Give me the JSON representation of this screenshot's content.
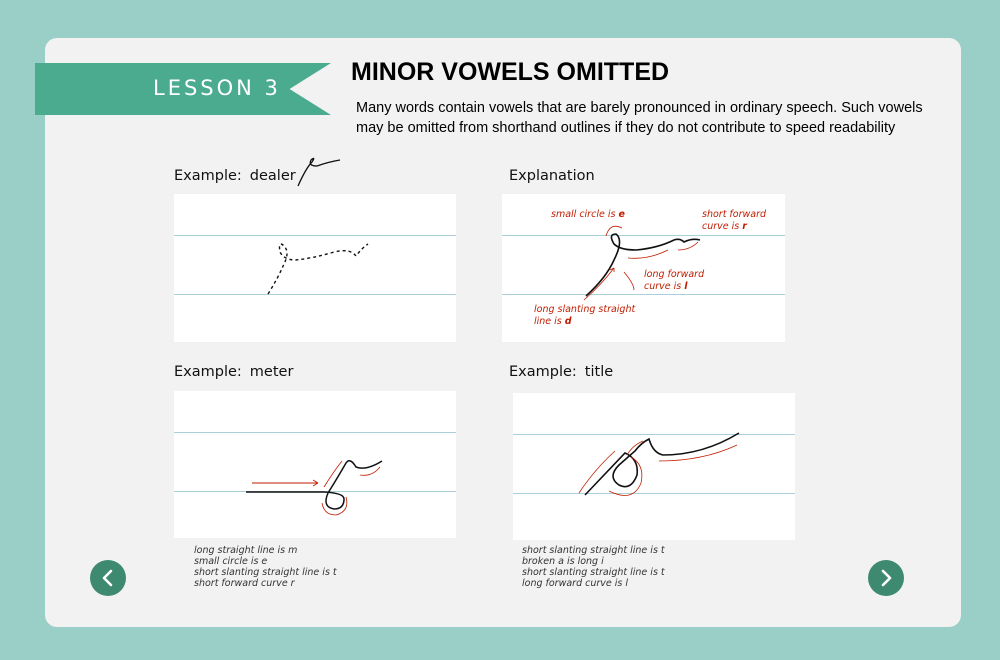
{
  "lesson": {
    "label": "LESSON 3"
  },
  "title": "MINOR VOWELS OMITTED",
  "intro": "Many words contain vowels that are barely pronounced in ordinary speech. Such vowels may be omitted from shorthand outlines if they do not contribute to speed readability",
  "examples": [
    {
      "prefix": "Example:",
      "word": "dealer"
    },
    {
      "prefix": "Example:",
      "word": "meter",
      "notes": [
        "long straight line is m",
        "small circle is e",
        "short slanting straight line is t",
        "short forward curve r"
      ]
    },
    {
      "prefix": "Example:",
      "word": "title",
      "notes": [
        "short slanting straight line is t",
        "broken a is long i",
        "short slanting straight line is t",
        "long forward curve is l"
      ]
    }
  ],
  "explanation": {
    "heading": "Explanation",
    "annotations": {
      "circle": {
        "text": "small circle is",
        "letter": "e"
      },
      "r": {
        "line1": "short forward",
        "line2": "curve is",
        "letter": "r"
      },
      "l": {
        "line1": "long forward",
        "line2": "curve is",
        "letter": "l"
      },
      "d": {
        "line1": "long slanting straight",
        "line2": "line is",
        "letter": "d"
      }
    }
  },
  "nav": {
    "prev_icon": "chevron-left-icon",
    "next_icon": "chevron-right-icon"
  },
  "colors": {
    "background": "#99cfc7",
    "ribbon": "#4aab8e",
    "nav": "#3e8a70",
    "annotation": "#c21d00",
    "ruled_line": "#a9cfd8"
  }
}
